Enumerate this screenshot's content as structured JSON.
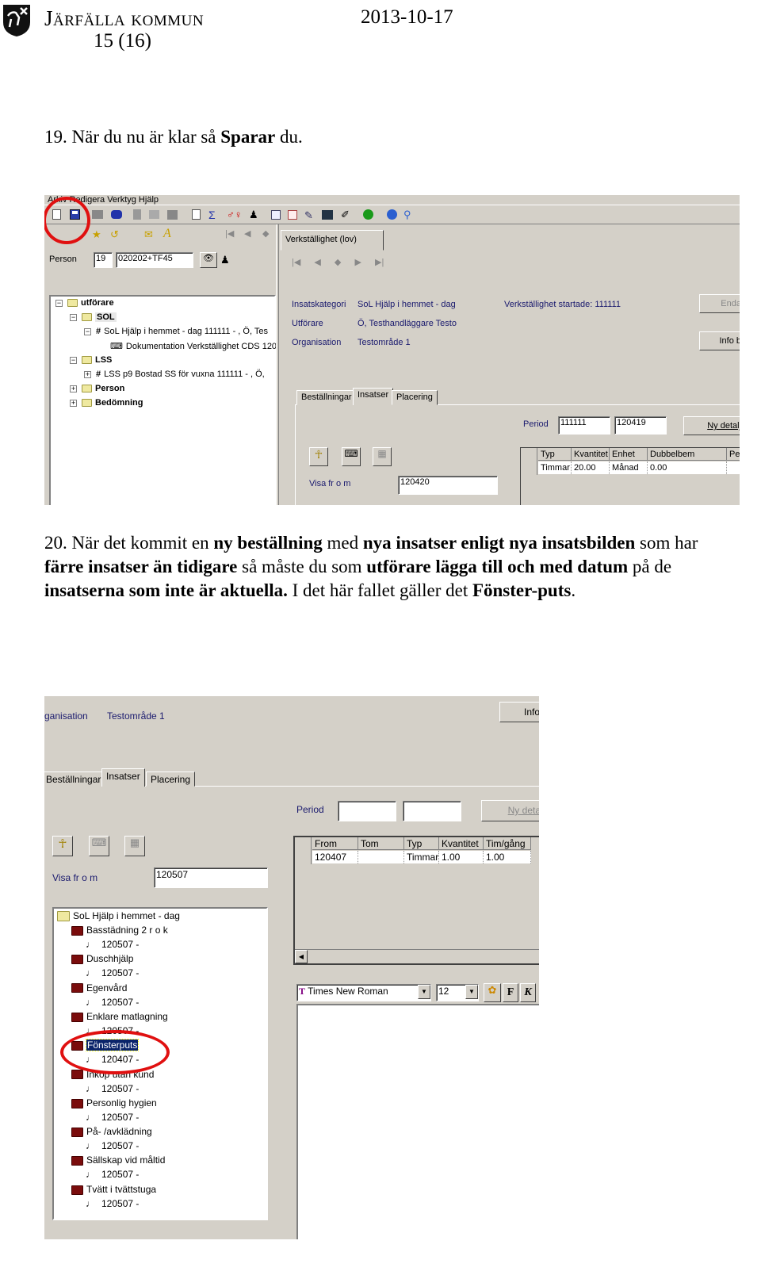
{
  "header": {
    "organisation": "Järfälla kommun",
    "date": "2013-10-17",
    "page": "15 (16)",
    "logo": "coat-of-arms-logo"
  },
  "step19": {
    "number": "19.",
    "text_before": "När du nu är klar så ",
    "bold": "Sparar",
    "text_after": " du."
  },
  "step20": {
    "segments": [
      {
        "t": "20. När det kommit en ",
        "b": false
      },
      {
        "t": "ny beställning",
        "b": true
      },
      {
        "t": " med ",
        "b": false
      },
      {
        "t": "nya insatser enligt nya insatsbilden",
        "b": true
      },
      {
        "t": " som har ",
        "b": false
      },
      {
        "t": "färre insatser än tidigare",
        "b": true
      },
      {
        "t": " så måste du som ",
        "b": false
      },
      {
        "t": "utförare lägga till och med datum",
        "b": true
      },
      {
        "t": " på de ",
        "b": false
      },
      {
        "t": "insatserna som inte är aktuella.",
        "b": true
      },
      {
        "t": " I det här fallet gäller det ",
        "b": false
      },
      {
        "t": "Fönster-puts",
        "b": true
      },
      {
        "t": ".",
        "b": false
      }
    ]
  },
  "shot1": {
    "menu": "Arkiv  Redigera  Verktyg  Hjälp",
    "person_label": "Person",
    "person_nr": "19",
    "person_id": "020202+TF45",
    "tree": [
      {
        "label": "utförare",
        "bold": true,
        "level": 0,
        "exp": "−",
        "icon": "folder"
      },
      {
        "label": "SOL",
        "bold": true,
        "level": 1,
        "exp": "−",
        "icon": "folder"
      },
      {
        "label": "SoL Hjälp i hemmet - dag 111111 - , Ö, Tes",
        "level": 2,
        "exp": "−",
        "icon": "grid"
      },
      {
        "label": "Dokumentation Verkställighet CDS 120",
        "level": 3,
        "exp": "",
        "icon": "typewriter"
      },
      {
        "label": "LSS",
        "bold": true,
        "level": 1,
        "exp": "−",
        "icon": "folder"
      },
      {
        "label": "LSS  p9 Bostad SS för vuxna 111111 - , Ö,",
        "level": 2,
        "exp": "+",
        "icon": "grid"
      },
      {
        "label": "Person",
        "bold": true,
        "level": 1,
        "exp": "+",
        "icon": "folder"
      },
      {
        "label": "Bedömning",
        "bold": true,
        "level": 1,
        "exp": "+",
        "icon": "folder"
      }
    ],
    "main_tab": "Verkställighet (lov)",
    "fields": [
      {
        "label": "Insatskategori",
        "value": "SoL Hjälp i hemmet - dag"
      },
      {
        "label": "Utförare",
        "value": "Ö, Testhandläggare Testo"
      },
      {
        "label": "Organisation",
        "value": "Testområde 1"
      }
    ],
    "started": "Verkställighet startade:  111111",
    "btn_end": "Enda",
    "btn_info": "Info b",
    "tabs": [
      "Beställningar",
      "Insatser",
      "Placering"
    ],
    "period_label": "Period",
    "period_from": "111111",
    "period_to": "120419",
    "btn_new": "Ny detalj",
    "grid_cols": [
      "Typ",
      "Kvantitet",
      "Enhet",
      "Dubbelbem",
      "Pe"
    ],
    "grid_row": [
      "Timmar",
      "20.00",
      "Månad",
      "0.00",
      ""
    ],
    "visa_label": "Visa fr o m",
    "visa_value": "120420"
  },
  "shot2": {
    "org_label": "ganisation",
    "org_value": "Testområde 1",
    "btn_info": "Info",
    "tabs": [
      "Beställningar",
      "Insatser",
      "Placering"
    ],
    "period_label": "Period",
    "period_from": "",
    "period_to": "",
    "btn_new": "Ny deta",
    "grid_cols": [
      "From",
      "Tom",
      "Typ",
      "Kvantitet",
      "Tim/gång"
    ],
    "grid_row": [
      "120407",
      "",
      "Timmar",
      "1.00",
      "1.00"
    ],
    "visa_label": "Visa fr o m",
    "visa_value": "120507",
    "tree_root": "SoL Hjälp i hemmet - dag",
    "tree": [
      {
        "label": "Basstädning 2 r o k",
        "date": "120507 -"
      },
      {
        "label": "Duschhjälp",
        "date": "120507 -"
      },
      {
        "label": "Egenvård",
        "date": "120507 -"
      },
      {
        "label": "Enklare matlagning",
        "date": "120507 -"
      },
      {
        "label": "Fönsterputs",
        "date": "120407 -",
        "selected": true
      },
      {
        "label": "Inköp utan kund",
        "date": "120507 -"
      },
      {
        "label": "Personlig hygien",
        "date": "120507 -"
      },
      {
        "label": "På- /avklädning",
        "date": "120507 -"
      },
      {
        "label": "Sällskap vid måltid",
        "date": "120507 -"
      },
      {
        "label": "Tvätt i tvättstuga",
        "date": "120507 -"
      }
    ],
    "font_name": "Times New Roman",
    "font_size": "12",
    "bold_btn": "F",
    "italic_btn": "K"
  },
  "colors": {
    "highlight": "#e01010",
    "window": "#d4d0c8",
    "label_blue": "#1a1a6e",
    "selection": "#0a246a"
  }
}
